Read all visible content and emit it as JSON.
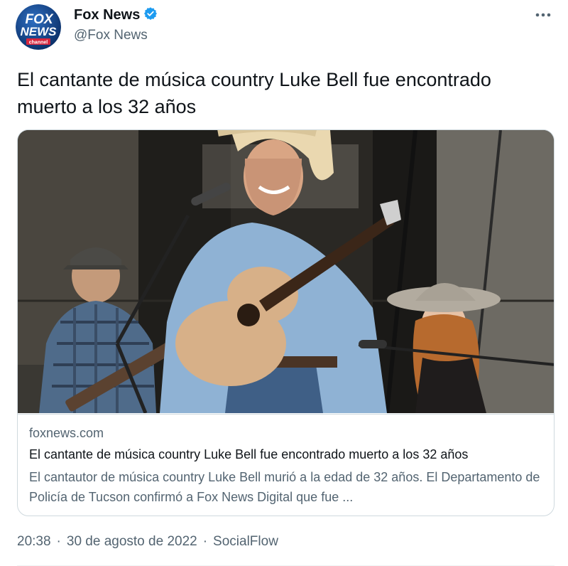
{
  "author": {
    "name": "Fox News",
    "handle": "@Fox News",
    "verified": true,
    "avatar_logo": {
      "line1": "FOX",
      "line2": "NEWS",
      "line3": "channel"
    }
  },
  "tweet": {
    "text": "El cantante de música country Luke Bell fue encontrado muerto a los 32 años"
  },
  "card": {
    "domain": "foxnews.com",
    "title": "El cantante de música country Luke Bell fue encontrado muerto a los 32 años",
    "description": "El cantautor de música country Luke Bell murió a la edad de 32 años. El Departamento de Policía de Tucson confirmó a Fox News Digital que fue ..."
  },
  "meta": {
    "time": "20:38",
    "separator": "·",
    "date": "30 de agosto de 2022",
    "source": "SocialFlow"
  },
  "icons": {
    "verified_badge": "verified-badge-icon",
    "more": "more-options-icon"
  },
  "colors": {
    "verified": "#1d9bf0",
    "secondary_text": "#536471",
    "border": "#cfd9de",
    "fox_blue": "#003366",
    "fox_red": "#d7263d"
  }
}
